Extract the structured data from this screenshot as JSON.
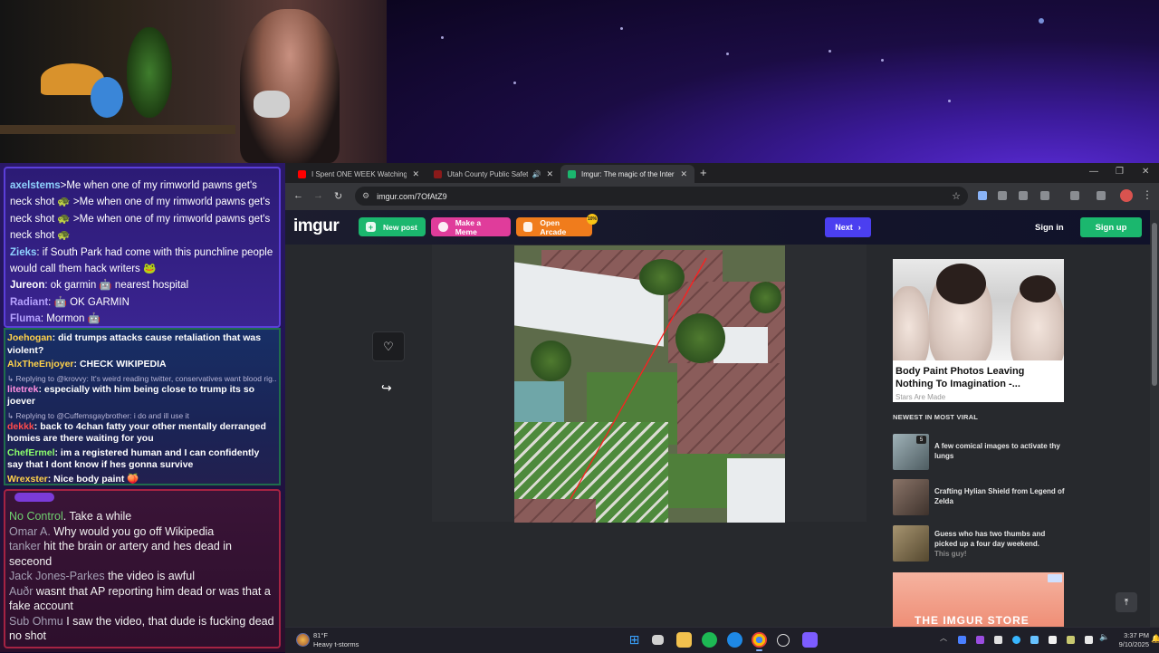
{
  "chat": {
    "top": [
      {
        "user": "axelstems",
        "color": "#8fd3ff",
        "text": ">Me when one of my rimworld pawns get's"
      },
      {
        "user": "",
        "color": "#ffffff",
        "text": "neck shot 🐢 >Me when one of my rimworld pawns get's"
      },
      {
        "user": "",
        "color": "#ffffff",
        "text": "neck shot 🐢 >Me when one of my rimworld pawns get's"
      },
      {
        "user": "",
        "color": "#ffffff",
        "text": "neck shot 🐢"
      },
      {
        "user": "Zieks",
        "color": "#8fd3ff",
        "text": ": if South Park had come with this punchline people"
      },
      {
        "user": "",
        "color": "#ffffff",
        "text": "would call them hack writers 🐸"
      },
      {
        "user": "Jureon",
        "color": "#ffffff",
        "text": ": ok garmin 🤖 nearest hospital"
      },
      {
        "user": "Radiant",
        "color": "#b6a2ff",
        "text": ": 🤖 OK GARMIN"
      },
      {
        "user": "Fluma",
        "color": "#b6a2ff",
        "text": ": Mormon 🤖"
      }
    ],
    "middle": [
      {
        "reply": "",
        "user": "Joehogan",
        "color": "#ffd24a",
        "text": ": did trumps attacks cause retaliation that was violent?"
      },
      {
        "reply": "",
        "user": "AlxTheEnjoyer",
        "color": "#ffd24a",
        "text": ": CHECK WIKIPEDIA"
      },
      {
        "reply": "↳ Replying to @krovvy: It's weird reading twitter, conservatives want blood rig...",
        "user": "litetrek",
        "color": "#ff8fe0",
        "text": ": especially with him being close to trump its so joever"
      },
      {
        "reply": "↳ Replying to @Cuffemsgaybrother: i do and ill use it",
        "user": "dekkk",
        "color": "#ff4b4b",
        "text": ": back to 4chan fatty your other mentally derranged homies are there waiting for you"
      },
      {
        "reply": "",
        "user": "ChefErmel",
        "color": "#8cff6b",
        "text": ": im a registered human and I can confidently say that I dont know if hes gonna survive"
      },
      {
        "reply": "",
        "user": "Wrexster",
        "color": "#ffd24a",
        "text": ": Nice body paint 🍑"
      }
    ],
    "bottom": [
      {
        "user": "No Control",
        "green": true,
        "text": ". Take a while"
      },
      {
        "user": "Omar A.",
        "green": false,
        "text": " Why would you go off Wikipedia"
      },
      {
        "user": "tanker",
        "green": false,
        "text": " hit the brain or artery and hes dead in seceond"
      },
      {
        "user": "Jack Jones-Parkes",
        "green": false,
        "text": " the video is awful"
      },
      {
        "user": "Auðr",
        "green": false,
        "text": " wasnt that AP reporting him dead or was that a fake account"
      },
      {
        "user": "Sub Ohmu",
        "green": false,
        "text": " I saw the video, that dude is fucking dead no shot"
      }
    ]
  },
  "browser": {
    "tabs": [
      {
        "title": "I Spent ONE WEEK Watching (H",
        "favicon_color": "#ff0000",
        "active": false,
        "sound": false
      },
      {
        "title": "Utah County Public Safety |",
        "favicon_color": "#8b1a1a",
        "active": false,
        "sound": true
      },
      {
        "title": "Imgur: The magic of the Intern",
        "favicon_color": "#1bb76e",
        "active": true,
        "sound": false
      }
    ],
    "new_tab": "+",
    "url": "imgur.com/7OfAtZ9"
  },
  "imgur": {
    "logo": "imgur",
    "new_post": "New post",
    "make_meme": "Make a Meme",
    "open_arcade": "Open Arcade",
    "arcade_badge": "10%",
    "next": "Next",
    "sign_in": "Sign in",
    "sign_up": "Sign up",
    "ad": {
      "title": "Body Paint Photos Leaving Nothing To Imagination -...",
      "sponsor": "Stars Are Made"
    },
    "viral_heading": "NEWEST IN MOST VIRAL",
    "viral": [
      {
        "title": "A few comical images to activate thy lungs",
        "sub": "",
        "count": "5",
        "thumb": "#7d8f98"
      },
      {
        "title": "Crafting Hylian Shield from Legend of Zelda",
        "sub": "",
        "count": "",
        "thumb": "#6b5a52"
      },
      {
        "title": "Guess who has two thumbs and picked up a four day weekend.",
        "sub": "This guy!",
        "count": "",
        "thumb": "#8c7b5a"
      }
    ],
    "store_text": "THE IMGUR STORE"
  },
  "taskbar": {
    "temp": "81°F",
    "weather": "Heavy t-storms",
    "time": "3:37 PM",
    "date": "9/10/2025"
  }
}
